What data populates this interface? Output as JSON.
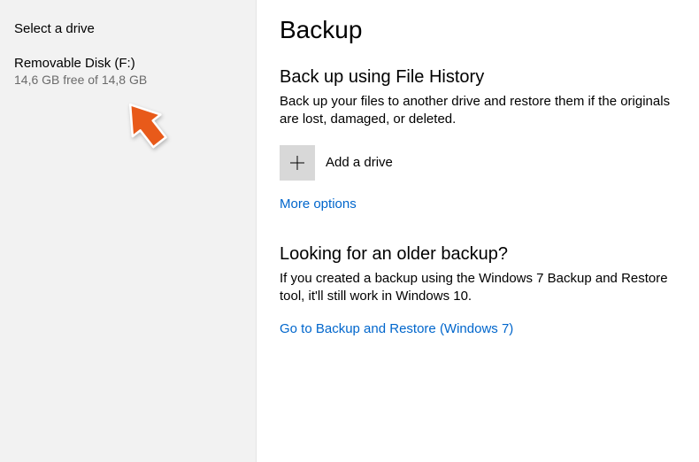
{
  "left": {
    "title": "Select a drive",
    "drive": {
      "name": "Removable Disk (F:)",
      "free": "14,6 GB free of 14,8 GB"
    }
  },
  "right": {
    "title": "Backup",
    "fileHistory": {
      "heading": "Back up using File History",
      "desc": "Back up your files to another drive and restore them if the originals are lost, damaged, or deleted.",
      "addDrive": "Add a drive",
      "moreOptions": "More options"
    },
    "older": {
      "heading": "Looking for an older backup?",
      "desc": "If you created a backup using the Windows 7 Backup and Restore tool, it'll still work in Windows 10.",
      "link": "Go to Backup and Restore (Windows 7)"
    }
  }
}
